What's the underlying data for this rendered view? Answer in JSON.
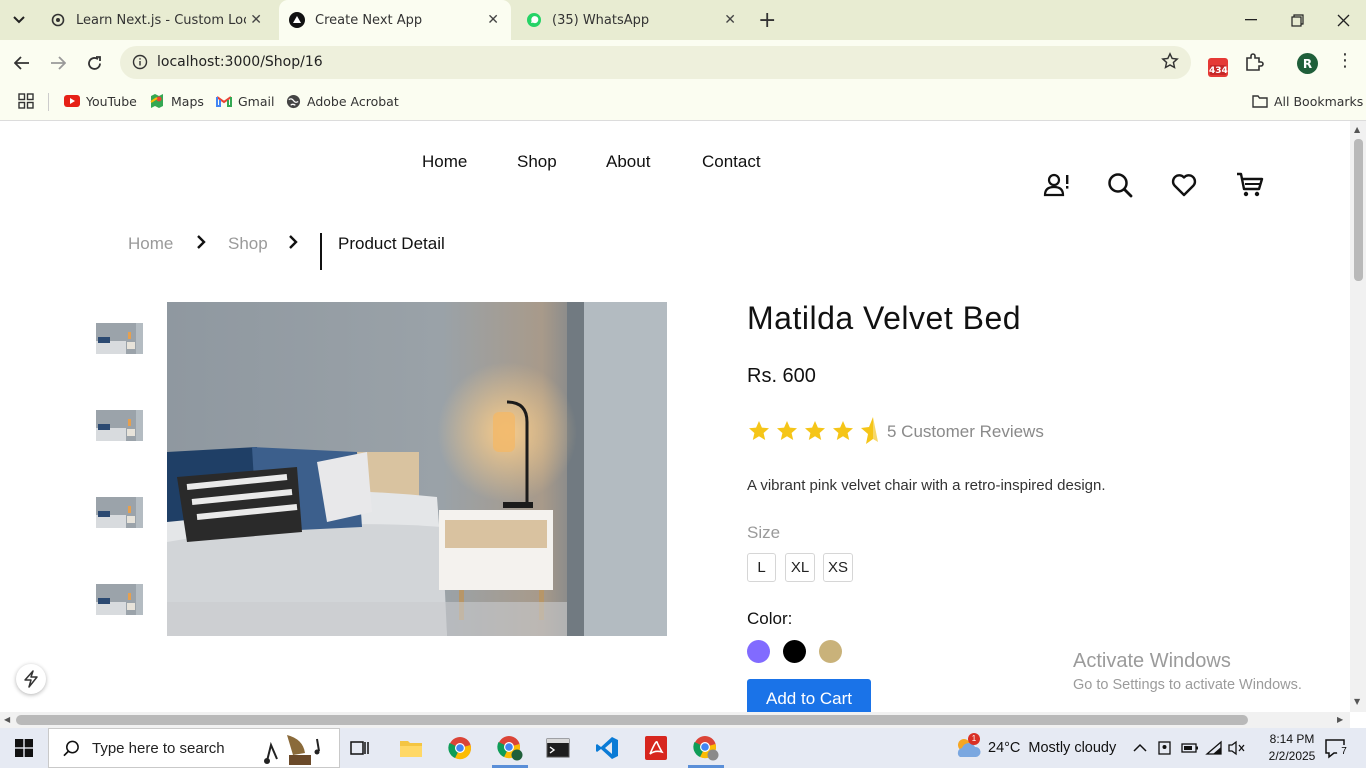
{
  "browser": {
    "tabs": [
      {
        "label": "Learn Next.js - Custom Localhost",
        "active": false
      },
      {
        "label": "Create Next App",
        "active": true
      },
      {
        "label": "(35) WhatsApp",
        "active": false
      }
    ],
    "url": "localhost:3000/Shop/16",
    "extension_badge": "434",
    "profile_initial": "R",
    "bookmarks": [
      "YouTube",
      "Maps",
      "Gmail",
      "Adobe Acrobat"
    ],
    "all_bookmarks": "All Bookmarks"
  },
  "site": {
    "nav": [
      "Home",
      "Shop",
      "About",
      "Contact"
    ],
    "header_icons": [
      "user-alert-icon",
      "search-icon",
      "heart-icon",
      "cart-icon"
    ]
  },
  "breadcrumb": {
    "home": "Home",
    "shop": "Shop",
    "current": "Product Detail"
  },
  "product": {
    "title": "Matilda Velvet Bed",
    "price": "Rs. 600",
    "rating": 4.5,
    "reviews": "5 Customer Reviews",
    "description": "A vibrant pink velvet chair with a retro-inspired design.",
    "size_label": "Size",
    "sizes": [
      "L",
      "XL",
      "XS"
    ],
    "color_label": "Color:",
    "colors": [
      "#816bff",
      "#000000",
      "#c9b27a"
    ],
    "add_to_cart": "Add to Cart",
    "thumbnail_count": 4
  },
  "watermark": {
    "line1": "Activate Windows",
    "line2": "Go to Settings to activate Windows."
  },
  "taskbar": {
    "search_placeholder": "Type here to search",
    "weather_temp": "24°C",
    "weather_desc": "Mostly cloudy",
    "weather_badge": "1",
    "time": "8:14 PM",
    "date": "2/2/2025",
    "notifications": "7"
  },
  "colors": {
    "accent": "#1a73e8",
    "star": "#f5c518",
    "tabbar": "#e8ecd2",
    "toolbar": "#fbfdf1"
  }
}
